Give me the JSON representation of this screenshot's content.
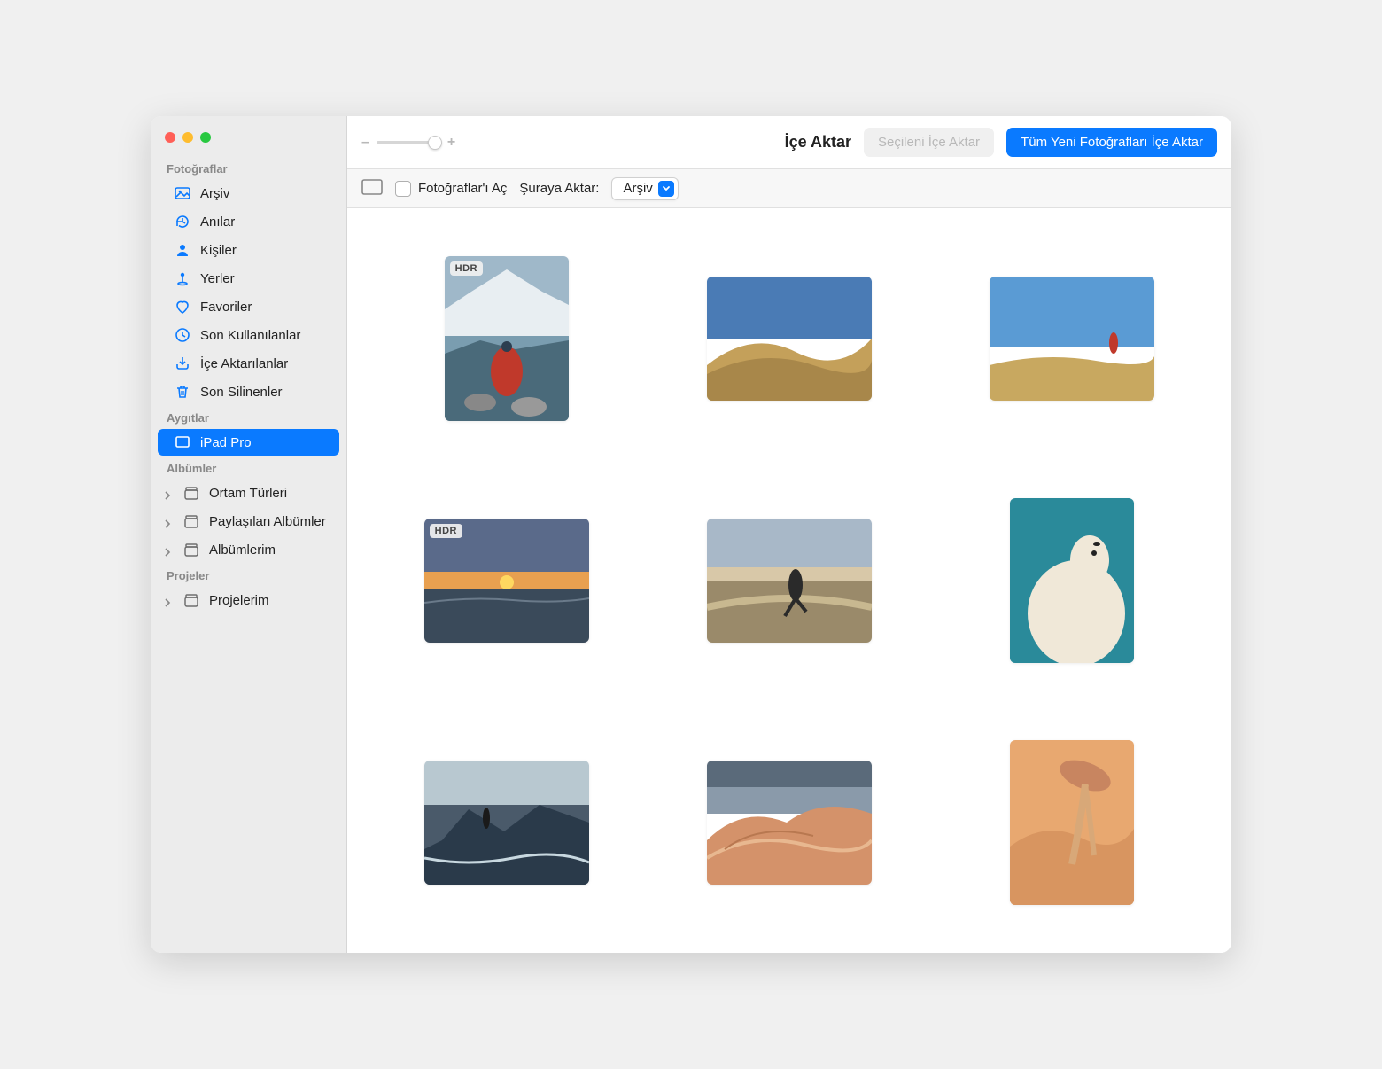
{
  "toolbar": {
    "title": "İçe Aktar",
    "import_selected_label": "Seçileni İçe Aktar",
    "import_all_label": "Tüm Yeni Fotoğrafları İçe Aktar",
    "zoom_minus": "–",
    "zoom_plus": "+"
  },
  "subtoolbar": {
    "open_photos_label": "Fotoğraflar'ı Aç",
    "import_to_label": "Şuraya Aktar:",
    "import_to_value": "Arşiv"
  },
  "sidebar": {
    "section_photos": "Fotoğraflar",
    "section_devices": "Aygıtlar",
    "section_albums": "Albümler",
    "section_projects": "Projeler",
    "items_photos": [
      {
        "label": "Arşiv",
        "icon": "photo"
      },
      {
        "label": "Anılar",
        "icon": "memories"
      },
      {
        "label": "Kişiler",
        "icon": "people"
      },
      {
        "label": "Yerler",
        "icon": "places"
      },
      {
        "label": "Favoriler",
        "icon": "heart"
      },
      {
        "label": "Son Kullanılanlar",
        "icon": "clock"
      },
      {
        "label": "İçe Aktarılanlar",
        "icon": "import"
      },
      {
        "label": "Son Silinenler",
        "icon": "trash"
      }
    ],
    "items_devices": [
      {
        "label": "iPad Pro",
        "icon": "ipad",
        "selected": true
      }
    ],
    "items_albums": [
      {
        "label": "Ortam Türleri",
        "icon": "folder",
        "expandable": true
      },
      {
        "label": "Paylaşılan Albümler",
        "icon": "folder",
        "expandable": true
      },
      {
        "label": "Albümlerim",
        "icon": "folder",
        "expandable": true
      }
    ],
    "items_projects": [
      {
        "label": "Projelerim",
        "icon": "folder",
        "expandable": true
      }
    ]
  },
  "photos": [
    {
      "badge": "HDR",
      "orientation": "portrait"
    },
    {
      "badge": null,
      "orientation": "landscape"
    },
    {
      "badge": null,
      "orientation": "landscape"
    },
    {
      "badge": "HDR",
      "orientation": "landscape"
    },
    {
      "badge": null,
      "orientation": "landscape"
    },
    {
      "badge": null,
      "orientation": "portrait"
    },
    {
      "badge": null,
      "orientation": "landscape"
    },
    {
      "badge": null,
      "orientation": "landscape"
    },
    {
      "badge": null,
      "orientation": "portrait"
    }
  ],
  "badge_hdr": "HDR"
}
